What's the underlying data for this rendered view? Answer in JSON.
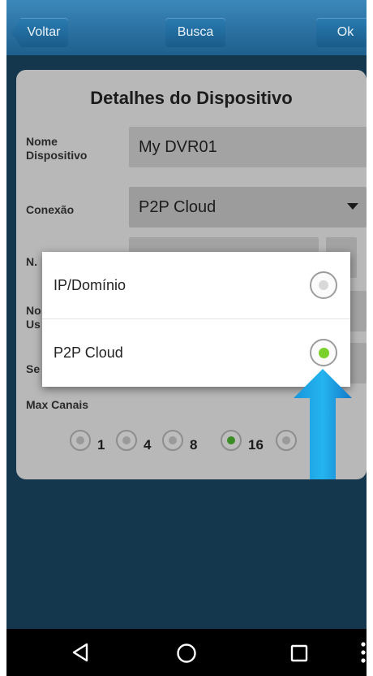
{
  "topbar": {
    "back_label": "Voltar",
    "search_label": "Busca",
    "ok_label": "Ok"
  },
  "form": {
    "title": "Detalhes do Dispositivo",
    "name_label_line1": "Nome",
    "name_label_line2": "Dispositivo",
    "name_value": "My DVR01",
    "connection_label": "Conexão",
    "connection_value": "P2P Cloud",
    "serial_label_partial": "N.",
    "user_label_partial_line1": "No",
    "user_label_partial_line2": "Us",
    "password_label_partial": "Se",
    "max_channels_label": "Max Canais",
    "channel_options": [
      "1",
      "4",
      "8",
      "16"
    ],
    "selected_channels": "16"
  },
  "dialog": {
    "options": [
      {
        "label": "IP/Domínio",
        "selected": false
      },
      {
        "label": "P2P Cloud",
        "selected": true
      }
    ]
  },
  "navbar": {
    "icons": [
      "back-triangle-icon",
      "home-circle-icon",
      "recents-square-icon",
      "more-dots-icon"
    ]
  },
  "colors": {
    "arrow": "#1aa6e6",
    "selected_radio": "#7bd12b",
    "topbar": "#2a74a8"
  }
}
